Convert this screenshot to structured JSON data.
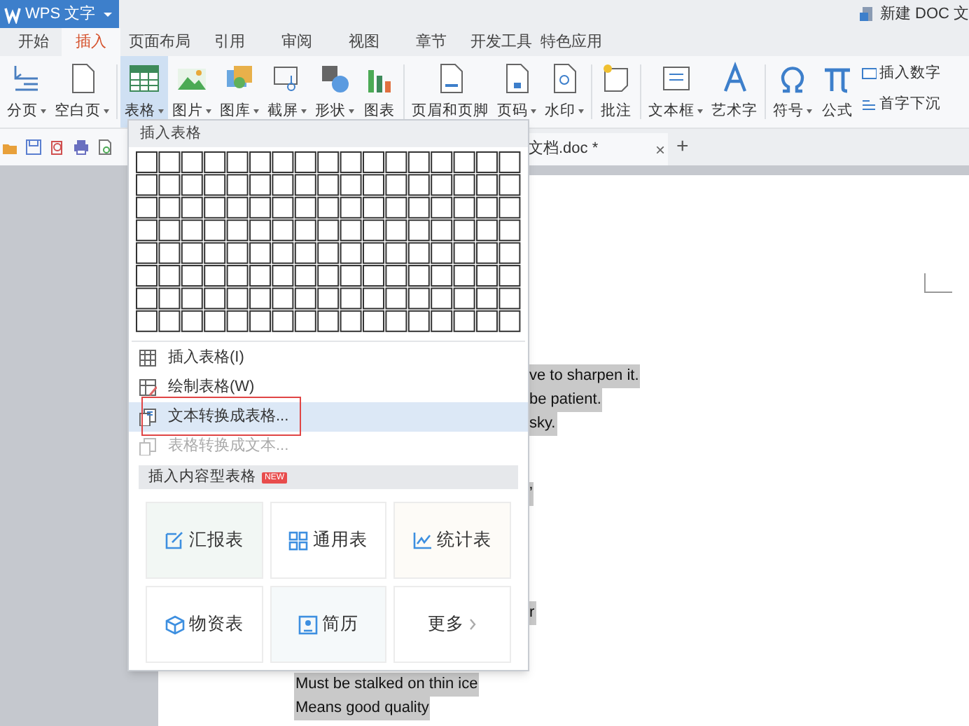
{
  "app": {
    "title": "WPS 文字",
    "document_title": "新建 DOC 文"
  },
  "tabs": [
    {
      "label": "开始",
      "selected": false
    },
    {
      "label": "插入",
      "selected": true
    },
    {
      "label": "页面布局",
      "selected": false
    },
    {
      "label": "引用",
      "selected": false
    },
    {
      "label": "审阅",
      "selected": false
    },
    {
      "label": "视图",
      "selected": false
    },
    {
      "label": "章节",
      "selected": false
    },
    {
      "label": "开发工具",
      "selected": false
    },
    {
      "label": "特色应用",
      "selected": false
    }
  ],
  "ribbon": [
    {
      "label": "分页",
      "dropdown": true,
      "selected": false
    },
    {
      "label": "空白页",
      "dropdown": true,
      "selected": false
    },
    {
      "label": "表格",
      "dropdown": true,
      "selected": true
    },
    {
      "label": "图片",
      "dropdown": true,
      "selected": false
    },
    {
      "label": "图库",
      "dropdown": true,
      "selected": false
    },
    {
      "label": "截屏",
      "dropdown": true,
      "selected": false
    },
    {
      "label": "形状",
      "dropdown": true,
      "selected": false
    },
    {
      "label": "图表",
      "dropdown": false,
      "selected": false
    },
    {
      "label": "页眉和页脚",
      "dropdown": false,
      "selected": false
    },
    {
      "label": "页码",
      "dropdown": true,
      "selected": false
    },
    {
      "label": "水印",
      "dropdown": true,
      "selected": false
    },
    {
      "label": "批注",
      "dropdown": false,
      "selected": false
    },
    {
      "label": "文本框",
      "dropdown": true,
      "selected": false
    },
    {
      "label": "艺术字",
      "dropdown": false,
      "selected": false
    },
    {
      "label": "符号",
      "dropdown": true,
      "selected": false
    },
    {
      "label": "公式",
      "dropdown": false,
      "selected": false
    }
  ],
  "ribbon_small": [
    "插入数字",
    "首字下沉"
  ],
  "doc_tab": {
    "label": "文档.doc *",
    "close": "×",
    "new": "+"
  },
  "document_lines": [
    "ve to sharpen it.",
    "be patient.",
    "sky.",
    "’",
    "r",
    "Must be stalked on thin ice",
    "Means good quality"
  ],
  "menu": {
    "header": "插入表格",
    "items": [
      {
        "label": "插入表格(I)",
        "selected": false,
        "disabled": false
      },
      {
        "label": "绘制表格(W)",
        "selected": false,
        "disabled": false
      },
      {
        "label": "文本转换成表格...",
        "selected": true,
        "disabled": false
      },
      {
        "label": "表格转换成文本...",
        "selected": false,
        "disabled": true
      }
    ],
    "section": "插入内容型表格",
    "badge": "NEW",
    "cards": [
      {
        "label": "汇报表",
        "kind": "report"
      },
      {
        "label": "通用表",
        "kind": "general"
      },
      {
        "label": "统计表",
        "kind": "stats"
      },
      {
        "label": "物资表",
        "kind": "supplies"
      },
      {
        "label": "简历",
        "kind": "resume"
      },
      {
        "label": "更多",
        "kind": "more"
      }
    ]
  }
}
